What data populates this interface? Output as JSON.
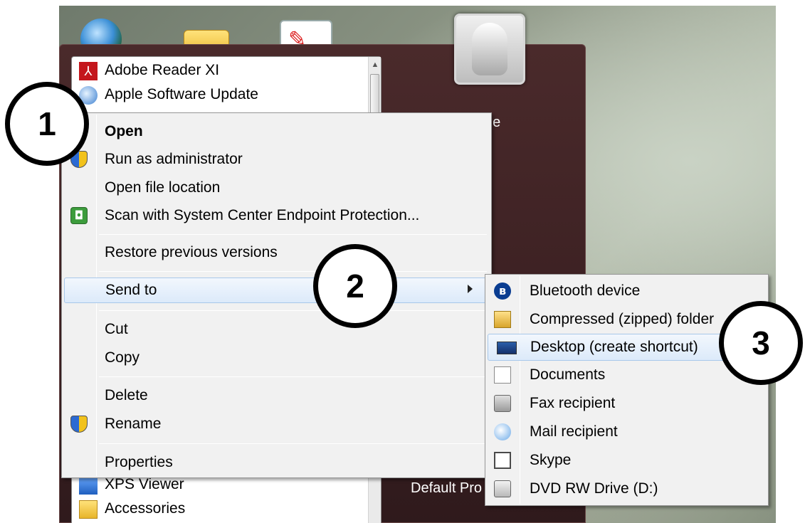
{
  "programs": {
    "items": [
      {
        "label": "Adobe Reader XI",
        "icon": "adobe-reader-icon"
      },
      {
        "label": "Apple Software Update",
        "icon": "apple-update-icon"
      },
      {
        "label": "XPS Viewer",
        "icon": "xps-viewer-icon"
      },
      {
        "label": "Accessories",
        "icon": "folder-icon"
      }
    ]
  },
  "right_pane": {
    "partial_label": "ne",
    "default_programs": "Default Pro"
  },
  "context_menu": {
    "open": "Open",
    "run_as_admin": "Run as administrator",
    "open_file_location": "Open file location",
    "scan": "Scan with System Center Endpoint Protection...",
    "restore": "Restore previous versions",
    "send_to": "Send to",
    "cut": "Cut",
    "copy": "Copy",
    "delete": "Delete",
    "rename": "Rename",
    "properties": "Properties"
  },
  "send_to_menu": {
    "items": [
      {
        "label": "Bluetooth device",
        "icon": "bluetooth-icon"
      },
      {
        "label": "Compressed (zipped) folder",
        "icon": "zip-folder-icon"
      },
      {
        "label": "Desktop (create shortcut)",
        "icon": "desktop-icon"
      },
      {
        "label": "Documents",
        "icon": "documents-icon"
      },
      {
        "label": "Fax recipient",
        "icon": "fax-icon"
      },
      {
        "label": "Mail recipient",
        "icon": "mail-icon"
      },
      {
        "label": "Skype",
        "icon": "skype-icon"
      },
      {
        "label": "DVD RW Drive (D:)",
        "icon": "dvd-drive-icon"
      }
    ]
  },
  "callouts": {
    "step1": "1",
    "step2": "2",
    "step3": "3"
  }
}
